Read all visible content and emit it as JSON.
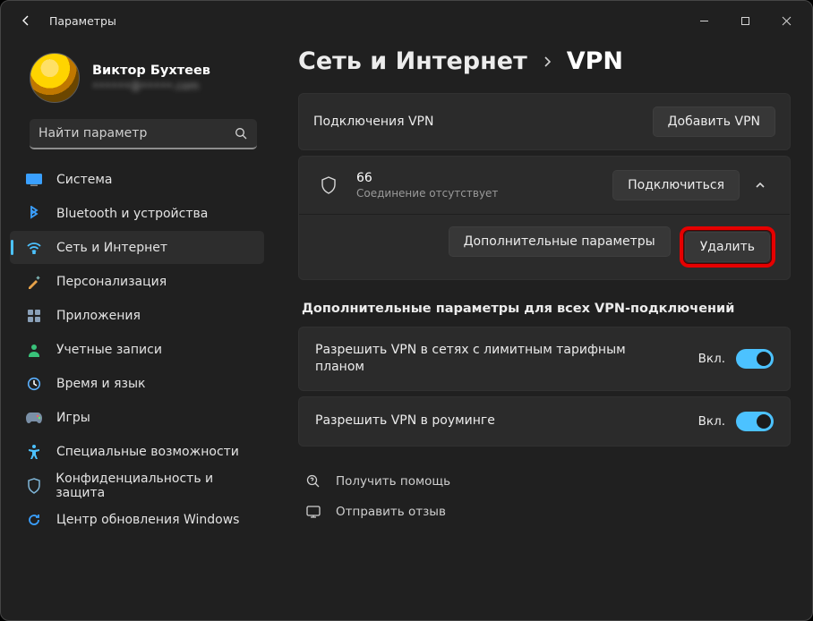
{
  "window": {
    "title": "Параметры"
  },
  "profile": {
    "name": "Виктор Бухтеев",
    "email": "••••••@•••••.com"
  },
  "search": {
    "placeholder": "Найти параметр"
  },
  "sidebar": {
    "items": [
      {
        "label": "Система",
        "icon": "system",
        "active": false
      },
      {
        "label": "Bluetooth и устройства",
        "icon": "bluetooth",
        "active": false
      },
      {
        "label": "Сеть и Интернет",
        "icon": "network",
        "active": true
      },
      {
        "label": "Персонализация",
        "icon": "personalize",
        "active": false
      },
      {
        "label": "Приложения",
        "icon": "apps",
        "active": false
      },
      {
        "label": "Учетные записи",
        "icon": "accounts",
        "active": false
      },
      {
        "label": "Время и язык",
        "icon": "time",
        "active": false
      },
      {
        "label": "Игры",
        "icon": "games",
        "active": false
      },
      {
        "label": "Специальные возможности",
        "icon": "accessibility",
        "active": false
      },
      {
        "label": "Конфиденциальность и защита",
        "icon": "privacy",
        "active": false
      },
      {
        "label": "Центр обновления Windows",
        "icon": "update",
        "active": false
      }
    ]
  },
  "breadcrumb": {
    "parent": "Сеть и Интернет",
    "child": "VPN"
  },
  "vpn": {
    "connections_label": "Подключения VPN",
    "add_button": "Добавить VPN",
    "item": {
      "name": "66",
      "status": "Соединение отсутствует",
      "connect_button": "Подключиться",
      "adv_button": "Дополнительные параметры",
      "delete_button": "Удалить"
    }
  },
  "advanced": {
    "title": "Дополнительные параметры для всех VPN-подключений",
    "rows": [
      {
        "label": "Разрешить VPN в сетях с лимитным тарифным планом",
        "state": "Вкл."
      },
      {
        "label": "Разрешить VPN в роуминге",
        "state": "Вкл."
      }
    ]
  },
  "footer": {
    "help": "Получить помощь",
    "feedback": "Отправить отзыв"
  }
}
